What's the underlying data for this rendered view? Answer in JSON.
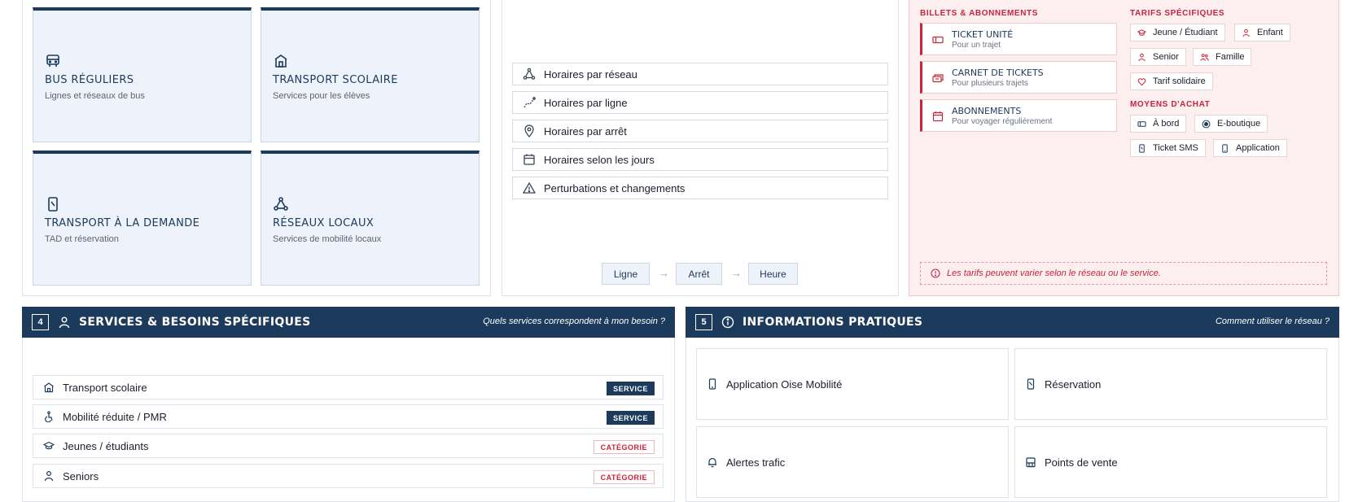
{
  "modes": [
    {
      "title": "BUS RÉGULIERS",
      "subtitle": "Lignes et réseaux de bus",
      "icon": "bus-icon"
    },
    {
      "title": "TRANSPORT SCOLAIRE",
      "subtitle": "Services pour les élèves",
      "icon": "school-icon"
    },
    {
      "title": "TRANSPORT À LA DEMANDE",
      "subtitle": "TAD et réservation",
      "icon": "phone-icon"
    },
    {
      "title": "RÉSEAUX LOCAUX",
      "subtitle": "Services de mobilité locaux",
      "icon": "network-icon"
    }
  ],
  "schedules": {
    "items": [
      {
        "label": "Horaires par réseau",
        "icon": "network-icon"
      },
      {
        "label": "Horaires par ligne",
        "icon": "route-icon"
      },
      {
        "label": "Horaires par arrêt",
        "icon": "map-pin-icon"
      },
      {
        "label": "Horaires selon les jours",
        "icon": "calendar-icon"
      },
      {
        "label": "Perturbations et changements",
        "icon": "warning-icon"
      }
    ],
    "steps": [
      "Ligne",
      "Arrêt",
      "Heure"
    ],
    "arrow": "→"
  },
  "tickets": {
    "heading": "BILLETS & ABONNEMENTS",
    "items": [
      {
        "title": "TICKET UNITÉ",
        "subtitle": "Pour un trajet",
        "icon": "ticket-icon"
      },
      {
        "title": "CARNET DE TICKETS",
        "subtitle": "Pour plusieurs trajets",
        "icon": "tickets-icon"
      },
      {
        "title": "ABONNEMENTS",
        "subtitle": "Pour voyager régulièrement",
        "icon": "calendar-icon"
      }
    ],
    "tariffs_heading": "TARIFS SPÉCIFIQUES",
    "tariffs": [
      "Jeune / Étudiant",
      "Enfant",
      "Senior",
      "Famille",
      "Tarif solidaire"
    ],
    "purchase_heading": "MOYENS D'ACHAT",
    "purchase": [
      "À bord",
      "E-boutique",
      "Ticket SMS",
      "Application"
    ],
    "note": "Les tarifs peuvent varier selon le réseau ou le service."
  },
  "services": {
    "number": "4",
    "title": "SERVICES & BESOINS SPÉCIFIQUES",
    "question": "Quels services correspondent à mon besoin ?",
    "rows": [
      {
        "label": "Transport scolaire",
        "badge": "SERVICE",
        "kind": "dark",
        "icon": "school-icon"
      },
      {
        "label": "Mobilité réduite / PMR",
        "badge": "SERVICE",
        "kind": "dark",
        "icon": "accessibility-icon"
      },
      {
        "label": "Jeunes / étudiants",
        "badge": "CATÉGORIE",
        "kind": "light",
        "icon": "graduation-cap-icon"
      },
      {
        "label": "Seniors",
        "badge": "CATÉGORIE",
        "kind": "light",
        "icon": "person-icon"
      }
    ]
  },
  "info": {
    "number": "5",
    "title": "INFORMATIONS PRATIQUES",
    "question": "Comment utiliser le réseau ?",
    "cards": [
      {
        "label": "Application Oise Mobilité",
        "icon": "smartphone-icon"
      },
      {
        "label": "Réservation",
        "icon": "phone-icon"
      },
      {
        "label": "Alertes trafic",
        "icon": "bell-icon"
      },
      {
        "label": "Points de vente",
        "icon": "store-icon"
      }
    ]
  }
}
